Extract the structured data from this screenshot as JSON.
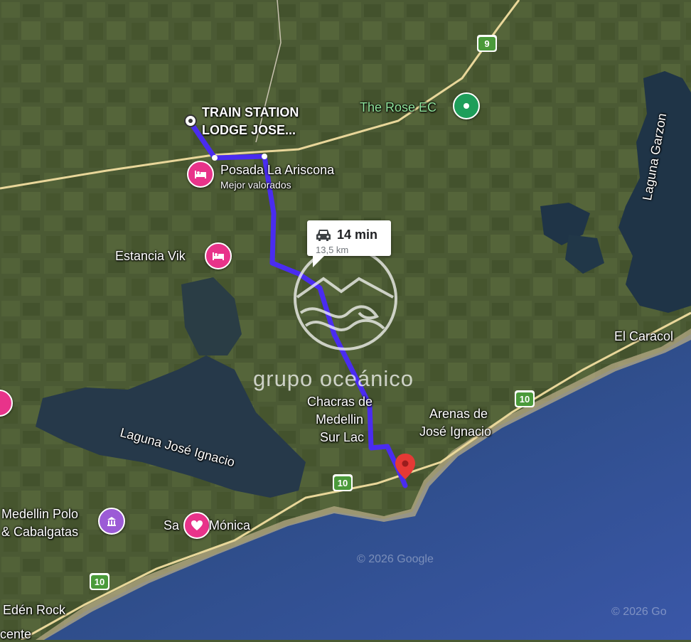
{
  "route": {
    "duration": "14 min",
    "distance": "13,5 km",
    "origin_label_line1": "TRAIN STATION",
    "origin_label_line2": "LODGE JOSE...",
    "route_color": "#4a2cf0"
  },
  "places": {
    "posada": "Posada La Ariscona",
    "posada_sub": "Mejor valorados",
    "estancia": "Estancia Vik",
    "rose": "The Rose EC",
    "laguna_garzon": "Laguna Garzon",
    "el_caracol": "El Caracol",
    "chacras_1": "Chacras de",
    "chacras_2": "Medellin",
    "chacras_3": "Sur Lac",
    "arenas_1": "Arenas de",
    "arenas_2": "José Ignacio",
    "laguna_jose": "Laguna José Ignacio",
    "polo_1": "Medellin Polo",
    "polo_2": "& Cabalgatas",
    "santa_monica_a": "Sa",
    "santa_monica_b": "Mónica",
    "eden_rock": "Edén Rock",
    "cente": "cente"
  },
  "roads": {
    "r9": "9",
    "r10a": "10",
    "r10b": "10",
    "r10c": "10"
  },
  "watermark": {
    "brand": "grupo oceánico",
    "copyright_1": "© 2026 Google",
    "copyright_2": "© 2026 Go"
  },
  "colors": {
    "lodging_pin": "#e8338a",
    "rose_pin": "#1e9e5a",
    "polo_pin": "#9c5bd6",
    "heart_pin": "#e8338a",
    "destination_pin": "#e53935",
    "ocean": "#2f4a93"
  },
  "icons": {
    "bed": "bed-icon",
    "heart": "heart-icon",
    "temple": "landmark-icon",
    "car": "car-icon",
    "park": "park-icon"
  }
}
